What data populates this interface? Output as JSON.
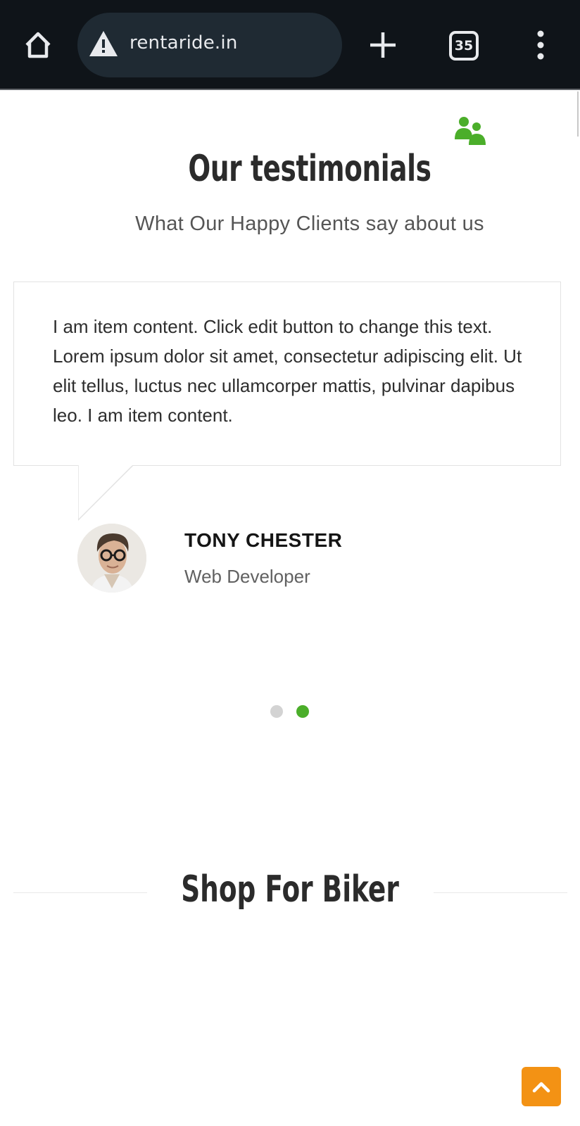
{
  "browser": {
    "url": "rentaride.in",
    "tab_count": "35",
    "icons": {
      "home": "home-icon",
      "warning": "not-secure-warning-icon",
      "new_tab": "plus-icon",
      "menu": "more-vert-icon"
    }
  },
  "testimonials": {
    "title": "Our testimonials",
    "subtitle": "What Our Happy Clients say about us",
    "icon": "users-icon",
    "items": [
      {
        "quote": "I am item content. Click edit button to change this text. Lorem ipsum dolor sit amet, consectetur adipiscing elit. Ut elit tellus, luctus nec ullamcorper mattis, pulvinar dapibus leo. I am item content.",
        "name": "TONY CHESTER",
        "role": "Web Developer"
      }
    ],
    "pagination": {
      "total": 2,
      "active": 2
    }
  },
  "shop": {
    "title": "Shop For Biker"
  },
  "back_to_top": {
    "icon": "chevron-up-icon"
  },
  "colors": {
    "accent_green": "#4bae2a",
    "back_to_top_orange": "#f39214",
    "heading": "#2b2b2b",
    "chrome_bg": "#0f1419"
  }
}
